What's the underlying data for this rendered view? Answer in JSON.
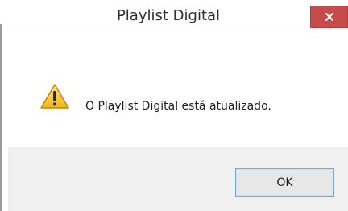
{
  "window": {
    "title": "Playlist Digital"
  },
  "titlebar": {
    "close_icon": "close-icon"
  },
  "dialog": {
    "icon": "warning-icon",
    "message": "O Playlist Digital está atualizado.",
    "ok_label": "OK"
  },
  "colors": {
    "close_button": "#c74b4b",
    "footer_background": "#f0f0f0",
    "button_border": "#7aa7d9",
    "warning_yellow": "#f2c232"
  }
}
